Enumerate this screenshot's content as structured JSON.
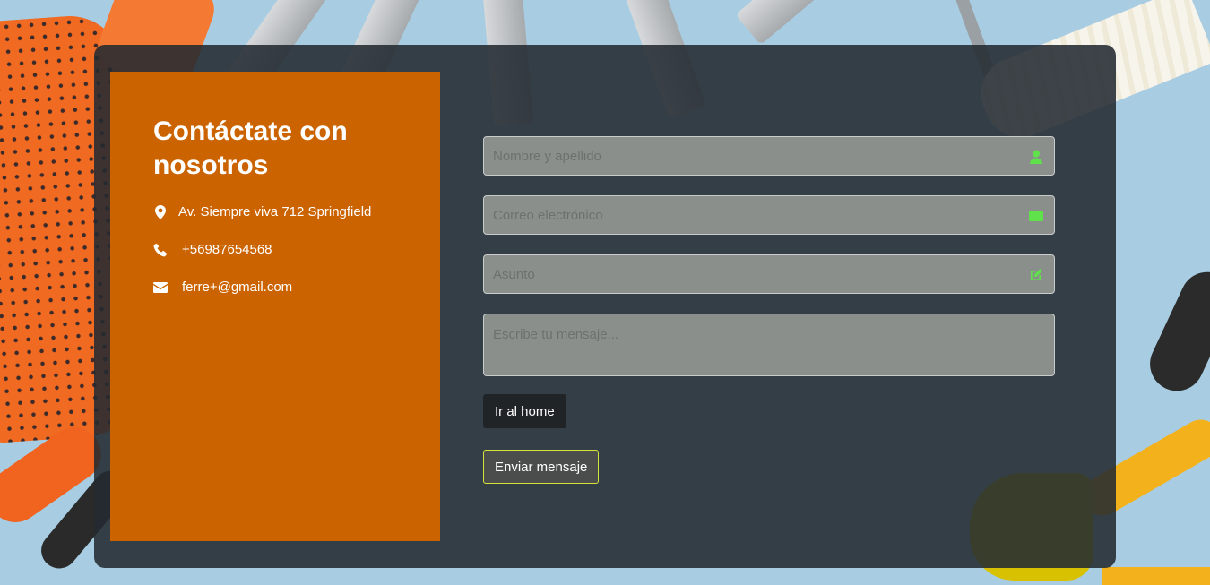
{
  "contact": {
    "title": "Contáctate con nosotros",
    "address": "Av. Siempre viva 712 Springfield",
    "phone": "+56987654568",
    "email": "ferre+@gmail.com",
    "icons": [
      "location-pin-icon",
      "phone-icon",
      "envelope-icon"
    ]
  },
  "form": {
    "name_placeholder": "Nombre y apellido",
    "email_placeholder": "Correo electrónico",
    "subject_placeholder": "Asunto",
    "message_placeholder": "Escribe tu mensaje...",
    "field_icons": [
      "user-icon",
      "envelope-icon",
      "edit-icon"
    ],
    "icon_color": "#5fe14b",
    "home_button": "Ir al home",
    "send_button": "Enviar mensaje"
  },
  "colors": {
    "panel": "#cb6300",
    "card": "#232a31",
    "send_border": "#d6e43a"
  }
}
